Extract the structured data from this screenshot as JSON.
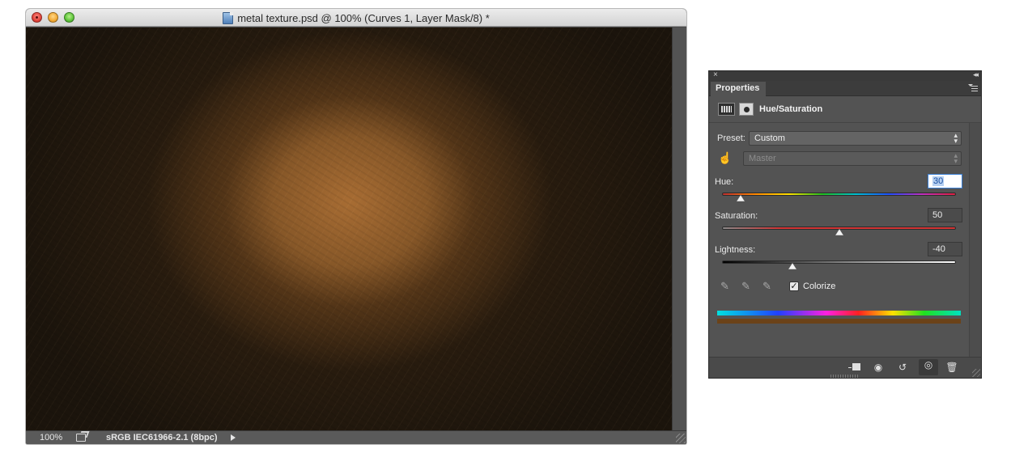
{
  "document_window": {
    "title": "metal texture.psd @ 100% (Curves 1, Layer Mask/8) *",
    "status": {
      "zoom": "100%",
      "profile": "sRGB IEC61966-2.1 (8bpc)"
    }
  },
  "properties_panel": {
    "close_glyph": "×",
    "collapse_glyph": "◂◂",
    "tab_label": "Properties",
    "adjustment_title": "Hue/Saturation",
    "preset": {
      "label": "Preset:",
      "value": "Custom"
    },
    "channel": {
      "value": "Master"
    },
    "sliders": [
      {
        "label": "Hue:",
        "value": "30",
        "fraction": 0.08
      },
      {
        "label": "Saturation:",
        "value": "50",
        "fraction": 0.5
      },
      {
        "label": "Lightness:",
        "value": "-40",
        "fraction": 0.3
      }
    ],
    "colorize": {
      "label": "Colorize",
      "checked": true,
      "check_glyph": "✓"
    },
    "icons": {
      "adjustment_layer": "hue-saturation-adjustment-icon",
      "layer_mask": "layer-mask-icon",
      "on_image_adjust": "hand-targeted-adjustment-icon",
      "eyedroppers": [
        "eyedropper-icon",
        "eyedropper-add-icon",
        "eyedropper-subtract-icon"
      ],
      "footer": [
        "clip-to-layer-icon",
        "view-previous-state-icon",
        "reset-adjustment-icon",
        "toggle-visibility-icon",
        "delete-layer-icon"
      ]
    },
    "colors": {
      "colorized_tone": "#6b4218",
      "accent_field": "#3a7fd6"
    }
  }
}
